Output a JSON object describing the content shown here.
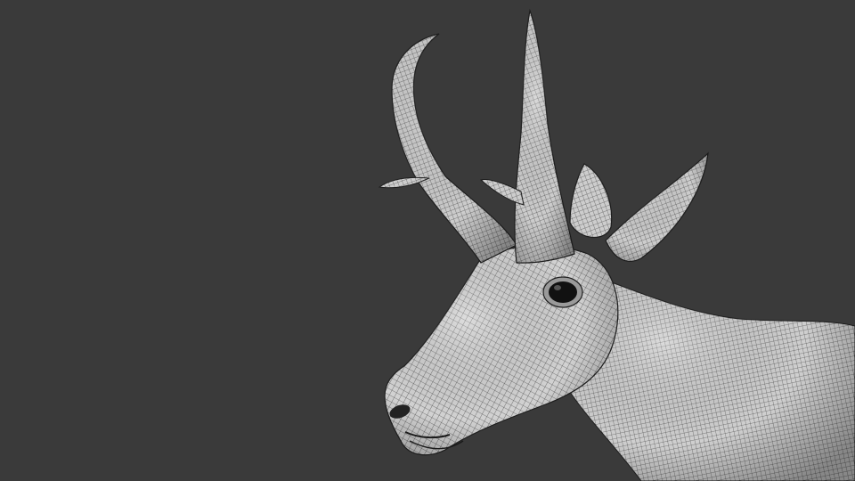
{
  "scene": {
    "background_color": "#3a3a3a",
    "mesh_color": "#d8d8d8",
    "wire_color": "#1e1e1e",
    "subject": "pronghorn-head-wireframe"
  }
}
